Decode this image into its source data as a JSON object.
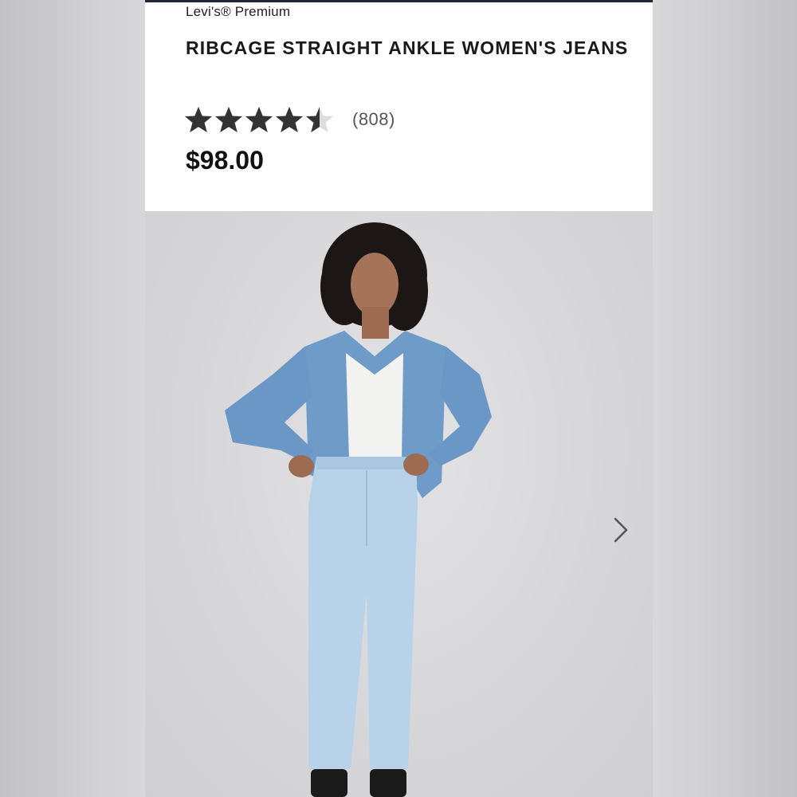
{
  "product": {
    "brand": "Levi's® Premium",
    "title": "RIBCAGE STRAIGHT ANKLE WOMEN'S JEANS",
    "rating": 4.5,
    "rating_max": 5,
    "review_count": "(808)",
    "price": "$98.00"
  },
  "gallery": {
    "current_image": "model-front-view",
    "next_icon": "chevron-right-icon"
  },
  "colors": {
    "top_bar": "#1f2a36",
    "star_filled": "#333333",
    "star_empty": "#dddddd"
  }
}
